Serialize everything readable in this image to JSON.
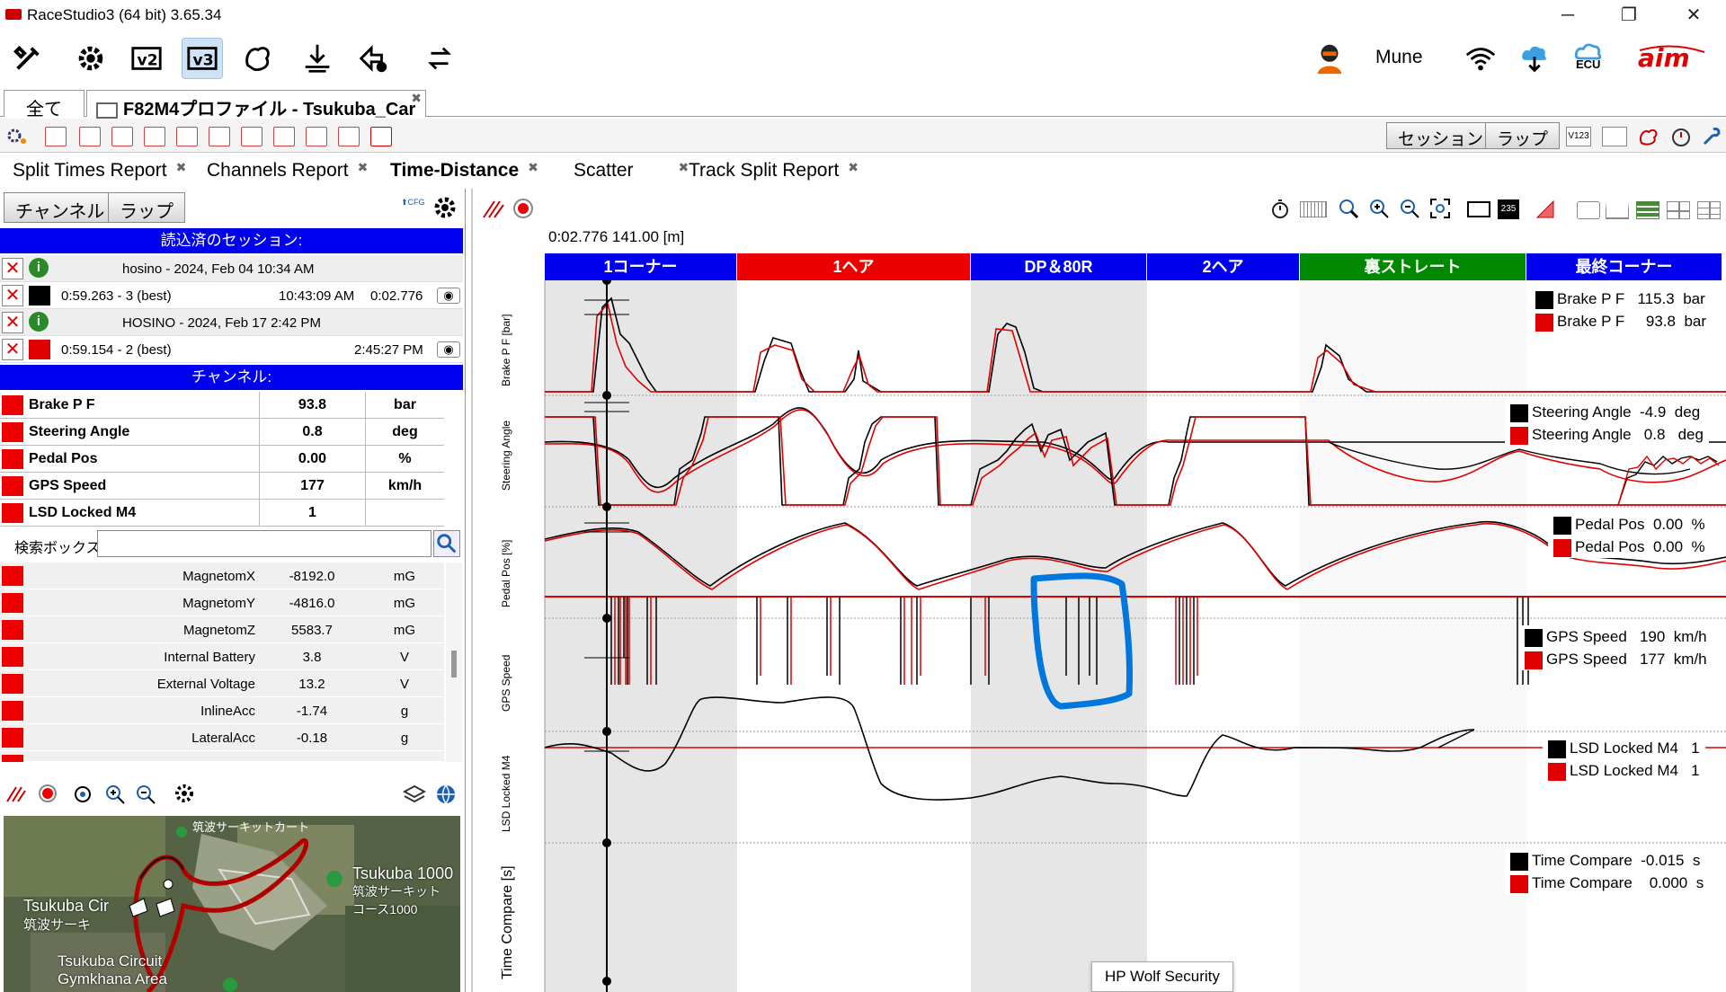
{
  "app": {
    "title": "RaceStudio3 (64 bit) 3.65.34",
    "user": "Mune",
    "ecu_label": "ECU"
  },
  "file_tabs": [
    {
      "label": "全て"
    },
    {
      "label": "F82M4プロファイル - Tsukuba_Car"
    }
  ],
  "session_buttons": {
    "session": "セッション",
    "lap": "ラップ"
  },
  "report_tabs": [
    {
      "label": "Split Times Report",
      "active": false
    },
    {
      "label": "Channels Report",
      "active": false
    },
    {
      "label": "Time-Distance",
      "active": true
    },
    {
      "label": "Scatter",
      "active": false
    },
    {
      "label": "Track Split Report",
      "active": false
    }
  ],
  "left": {
    "channel_btn": "チャンネル",
    "lap_btn": "ラップ",
    "loaded_header": "読込済のセッション:",
    "sessions": [
      {
        "name": "hosino - 2024, Feb 04 10:34 AM",
        "lap": "0:59.263 - 3 (best)",
        "time": "10:43:09 AM",
        "delta": "0:02.776",
        "color": "#000000"
      },
      {
        "name": "HOSINO - 2024, Feb 17 2:42 PM",
        "lap": "0:59.154 - 2 (best)",
        "time": "2:45:27 PM",
        "delta": "",
        "color": "#e00000"
      }
    ],
    "channel_header": "チャンネル:",
    "channels": [
      {
        "name": "Brake P F",
        "value": "93.8",
        "unit": "bar"
      },
      {
        "name": "Steering Angle",
        "value": "0.8",
        "unit": "deg"
      },
      {
        "name": "Pedal Pos",
        "value": "0.00",
        "unit": "%"
      },
      {
        "name": "GPS Speed",
        "value": "177",
        "unit": "km/h"
      },
      {
        "name": "LSD Locked M4",
        "value": "1",
        "unit": ""
      }
    ],
    "search_label": "検索ボックス",
    "list": [
      {
        "name": "MagnetomX",
        "value": "-8192.0",
        "unit": "mG"
      },
      {
        "name": "MagnetomY",
        "value": "-4816.0",
        "unit": "mG"
      },
      {
        "name": "MagnetomZ",
        "value": "5583.7",
        "unit": "mG"
      },
      {
        "name": "Internal Battery",
        "value": "3.8",
        "unit": "V"
      },
      {
        "name": "External Voltage",
        "value": "13.2",
        "unit": "V"
      },
      {
        "name": "InlineAcc",
        "value": "-1.74",
        "unit": "g"
      },
      {
        "name": "LateralAcc",
        "value": "-0.18",
        "unit": "g"
      }
    ],
    "map_labels": {
      "circuit": "Tsukuba 1000",
      "circuit_jp": "筑波サーキット コース1000",
      "tsukuba_circ": "Tsukuba Cir",
      "tsukuba_jp": "筑波サーキ",
      "gymkhana": "Tsukuba Circuit Gymkhana Area",
      "top": "筑波サーキットカート"
    }
  },
  "graph": {
    "cursor_readout": "0:02.776  141.00 [m]",
    "segments": [
      {
        "label": "1コーナー",
        "color": "#0000ee"
      },
      {
        "label": "1ヘア",
        "color": "#ee0000"
      },
      {
        "label": "DP＆80R",
        "color": "#0000ee"
      },
      {
        "label": "2ヘア",
        "color": "#0000ee"
      },
      {
        "label": "裏ストレート",
        "color": "#008800"
      },
      {
        "label": "最終コーナー",
        "color": "#0000ee"
      }
    ],
    "panels": [
      {
        "ylabel": "Brake P F [bar]",
        "legend": [
          {
            "name": "Brake P F",
            "value": "115.3",
            "unit": "bar",
            "color": "#000000"
          },
          {
            "name": "Brake P F",
            "value": "93.8",
            "unit": "bar",
            "color": "#e00000"
          }
        ]
      },
      {
        "ylabel": "Steering Angle",
        "legend": [
          {
            "name": "Steering Angle",
            "value": "-4.9",
            "unit": "deg",
            "color": "#000000"
          },
          {
            "name": "Steering Angle",
            "value": "0.8",
            "unit": "deg",
            "color": "#e00000"
          }
        ]
      },
      {
        "ylabel": "Pedal Pos [%]",
        "legend": [
          {
            "name": "Pedal Pos",
            "value": "0.00",
            "unit": "%",
            "color": "#000000"
          },
          {
            "name": "Pedal Pos",
            "value": "0.00",
            "unit": "%",
            "color": "#e00000"
          }
        ]
      },
      {
        "ylabel": "GPS Speed",
        "legend": [
          {
            "name": "GPS Speed",
            "value": "190",
            "unit": "km/h",
            "color": "#000000"
          },
          {
            "name": "GPS Speed",
            "value": "177",
            "unit": "km/h",
            "color": "#e00000"
          }
        ]
      },
      {
        "ylabel": "LSD Locked M4",
        "legend": [
          {
            "name": "LSD Locked M4",
            "value": "1",
            "unit": "",
            "color": "#000000"
          },
          {
            "name": "LSD Locked M4",
            "value": "1",
            "unit": "",
            "color": "#e00000"
          }
        ]
      },
      {
        "ylabel": "Time Compare [s]",
        "legend": [
          {
            "name": "Time Compare",
            "value": "-0.015",
            "unit": "s",
            "color": "#000000"
          },
          {
            "name": "Time Compare",
            "value": "0.000",
            "unit": "s",
            "color": "#e00000"
          }
        ]
      }
    ],
    "tooltip": "HP Wolf Security",
    "badge_235": "235"
  },
  "colors": {
    "accent_blue": "#0000f0",
    "series_a": "#000000",
    "series_b": "#e00000",
    "highlight": "#0077dd"
  }
}
